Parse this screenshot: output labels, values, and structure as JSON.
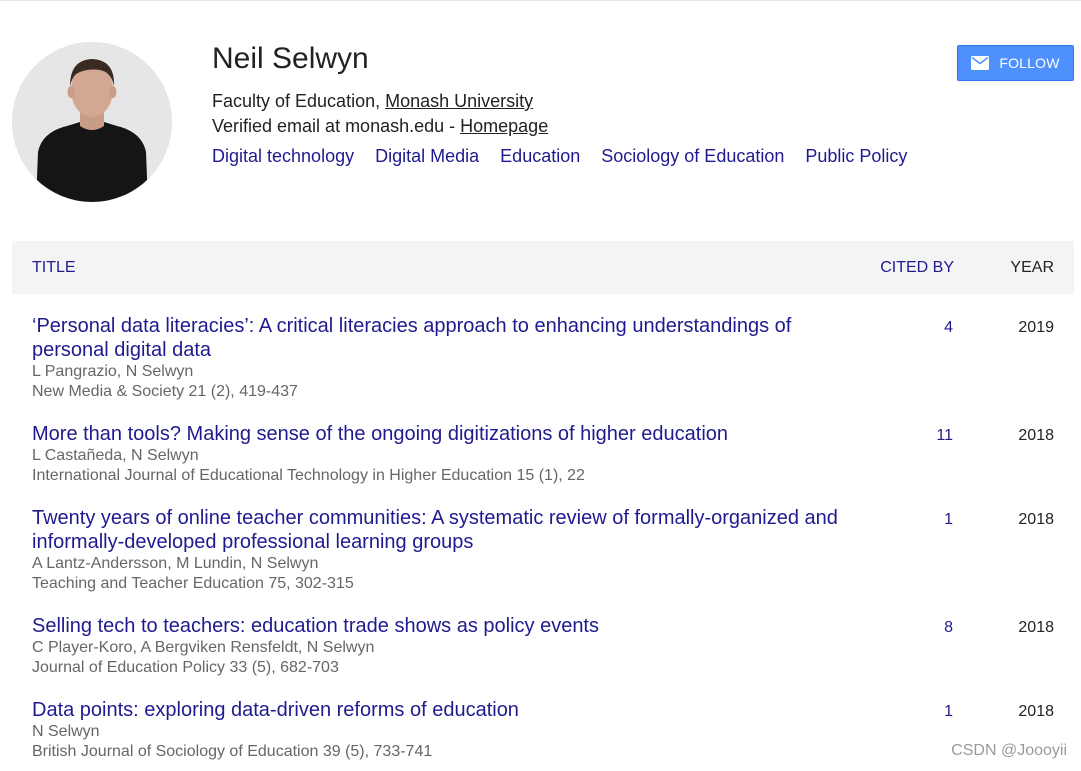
{
  "profile": {
    "name": "Neil Selwyn",
    "affiliation_prefix": "Faculty of Education, ",
    "affiliation_link": "Monash University",
    "email_text": "Verified email at monash.edu - ",
    "homepage_link": "Homepage",
    "interests": [
      "Digital technology",
      "Digital Media",
      "Education",
      "Sociology of Education",
      "Public Policy"
    ],
    "follow_label": "FOLLOW",
    "avatar_icon": "person-photo"
  },
  "table": {
    "headers": {
      "title": "TITLE",
      "cited_by": "CITED BY",
      "year": "YEAR"
    },
    "rows": [
      {
        "title": "‘Personal data literacies’: A critical literacies approach to enhancing understandings of personal digital data",
        "authors": "L Pangrazio, N Selwyn",
        "venue": "New Media & Society 21 (2), 419-437",
        "cited_by": "4",
        "year": "2019"
      },
      {
        "title": "More than tools? Making sense of the ongoing digitizations of higher education",
        "authors": "L Castañeda, N Selwyn",
        "venue": "International Journal of Educational Technology in Higher Education 15 (1), 22",
        "cited_by": "11",
        "year": "2018"
      },
      {
        "title": "Twenty years of online teacher communities: A systematic review of formally-organized and informally-developed professional learning groups",
        "authors": "A Lantz-Andersson, M Lundin, N Selwyn",
        "venue": "Teaching and Teacher Education 75, 302-315",
        "cited_by": "1",
        "year": "2018"
      },
      {
        "title": "Selling tech to teachers: education trade shows as policy events",
        "authors": "C Player-Koro, A Bergviken Rensfeldt, N Selwyn",
        "venue": "Journal of Education Policy 33 (5), 682-703",
        "cited_by": "8",
        "year": "2018"
      },
      {
        "title": "Data points: exploring data-driven reforms of education",
        "authors": "N Selwyn",
        "venue": "British Journal of Sociology of Education 39 (5), 733-741",
        "cited_by": "1",
        "year": "2018"
      }
    ]
  },
  "watermark": "CSDN @Joooyii",
  "colors": {
    "link": "#1f1b8f",
    "follow_button": "#4d90fe",
    "header_background": "#f4f4f4",
    "secondary_text": "#666666"
  }
}
